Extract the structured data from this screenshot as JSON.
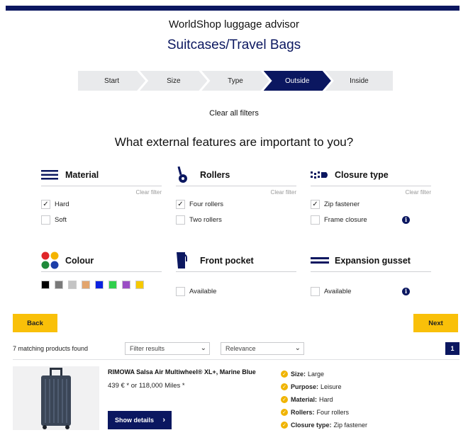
{
  "header": {
    "brand": "WorldShop luggage advisor",
    "title": "Suitcases/Travel Bags"
  },
  "steps": [
    {
      "label": "Start",
      "active": false
    },
    {
      "label": "Size",
      "active": false
    },
    {
      "label": "Type",
      "active": false
    },
    {
      "label": "Outside",
      "active": true
    },
    {
      "label": "Inside",
      "active": false
    }
  ],
  "clear_all": "Clear all filters",
  "question": "What external features are important to you?",
  "filters": {
    "clear_filter": "Clear filter",
    "material": {
      "title": "Material",
      "icon": "material-icon",
      "options": [
        {
          "label": "Hard",
          "checked": true
        },
        {
          "label": "Soft",
          "checked": false
        }
      ]
    },
    "rollers": {
      "title": "Rollers",
      "icon": "roller-icon",
      "options": [
        {
          "label": "Four rollers",
          "checked": true
        },
        {
          "label": "Two rollers",
          "checked": false
        }
      ]
    },
    "closure": {
      "title": "Closure type",
      "icon": "zipper-icon",
      "options": [
        {
          "label": "Zip fastener",
          "checked": true
        },
        {
          "label": "Frame closure",
          "checked": false
        }
      ]
    },
    "colour": {
      "title": "Colour",
      "icon": "colour-palette-icon",
      "swatches": [
        "#000000",
        "#7a7a7a",
        "#c4c4c4",
        "#e2a56e",
        "#0b22e0",
        "#30cf4d",
        "#9b4ec4",
        "#f6c900"
      ]
    },
    "front_pocket": {
      "title": "Front pocket",
      "icon": "front-pocket-icon",
      "options": [
        {
          "label": "Available",
          "checked": false
        }
      ]
    },
    "expansion": {
      "title": "Expansion gusset",
      "icon": "expansion-gusset-icon",
      "options": [
        {
          "label": "Available",
          "checked": false
        }
      ]
    }
  },
  "nav": {
    "back": "Back",
    "next": "Next"
  },
  "results": {
    "count_text": "7 matching products found",
    "filter_select": "Filter results",
    "sort_select": "Relevance",
    "page": "1"
  },
  "product": {
    "name": "RIMOWA Salsa Air Multiwheel® XL+, Marine Blue",
    "price": "439 € * or 118,000 Miles *",
    "show_details": "Show details",
    "features": [
      {
        "key": "Size:",
        "value": "Large"
      },
      {
        "key": "Purpose:",
        "value": "Leisure"
      },
      {
        "key": "Material:",
        "value": "Hard"
      },
      {
        "key": "Rollers:",
        "value": "Four rollers"
      },
      {
        "key": "Closure type:",
        "value": "Zip fastener"
      }
    ]
  },
  "colors": {
    "navy": "#0b1760",
    "accent_yellow": "#f9c009"
  }
}
